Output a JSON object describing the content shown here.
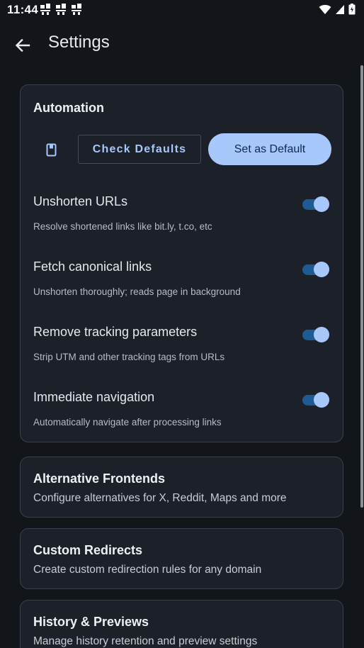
{
  "status": {
    "time": "11:44"
  },
  "appbar": {
    "title": "Settings"
  },
  "automation": {
    "title": "Automation",
    "check_defaults_label": "Check Defaults",
    "set_default_label": "Set as Default",
    "settings": [
      {
        "label": "Unshorten URLs",
        "desc": "Resolve shortened links like bit.ly, t.co, etc",
        "enabled": true
      },
      {
        "label": "Fetch canonical links",
        "desc": "Unshorten thoroughly; reads page in background",
        "enabled": true
      },
      {
        "label": "Remove tracking parameters",
        "desc": "Strip UTM and other tracking tags from URLs",
        "enabled": true
      },
      {
        "label": "Immediate navigation",
        "desc": "Automatically navigate after processing links",
        "enabled": true
      }
    ]
  },
  "sections": [
    {
      "title": "Alternative Frontends",
      "subtitle": "Configure alternatives for X, Reddit, Maps and more"
    },
    {
      "title": "Custom Redirects",
      "subtitle": "Create custom redirection rules for any domain"
    },
    {
      "title": "History & Previews",
      "subtitle": "Manage history retention and preview settings"
    }
  ],
  "colors": {
    "accent": "#a8c7fa",
    "toggle_track": "#1e5a93",
    "card_bg": "#1c2029",
    "background": "#12151a"
  }
}
